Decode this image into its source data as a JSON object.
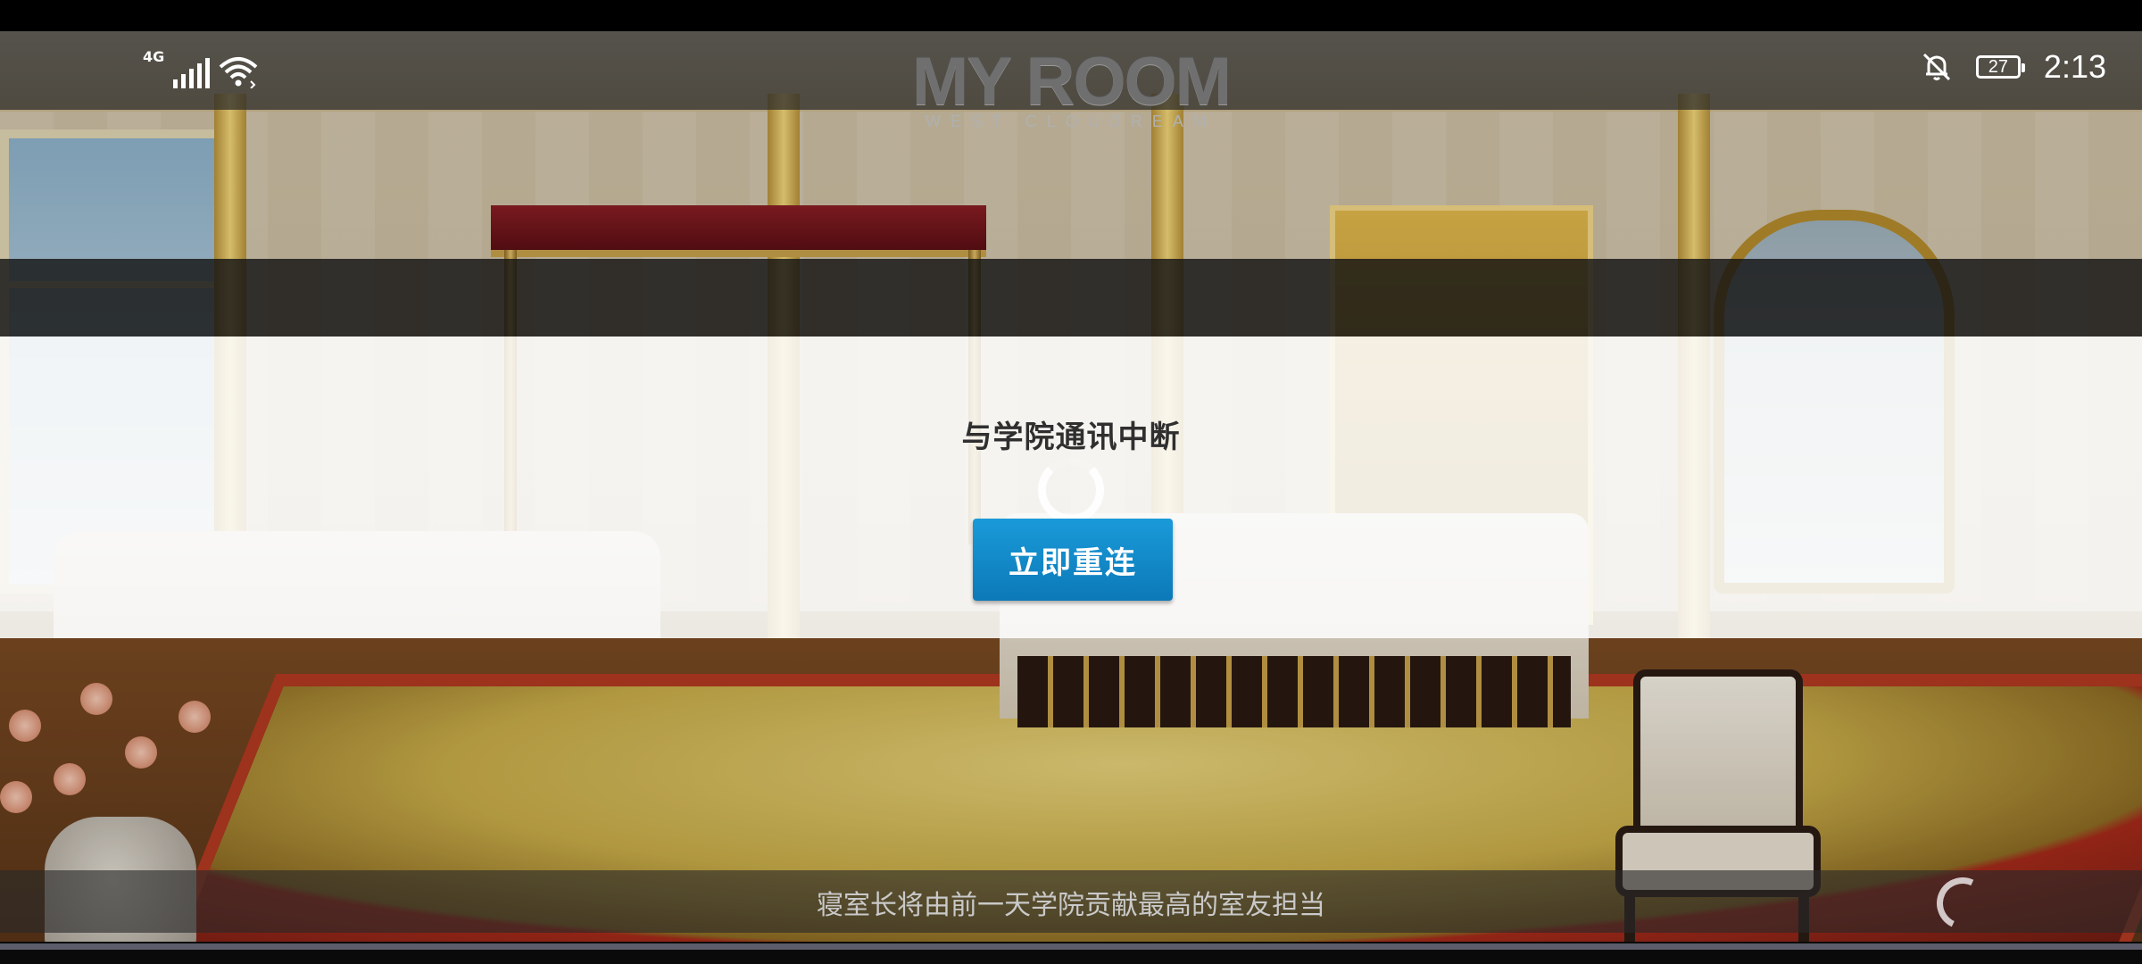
{
  "status_bar": {
    "network_type": "4G",
    "signal_icon": "cellular-signal-icon",
    "wifi_icon": "wifi-icon",
    "notification_icon": "bell-off-icon",
    "battery_level": "27",
    "time": "2:13"
  },
  "game": {
    "logo_title": "MY ROOM",
    "logo_subtitle": "WEST CLOUDREAM"
  },
  "dialog": {
    "message": "与学院通讯中断",
    "reconnect_button": "立即重连",
    "accent_color": "#138bcb"
  },
  "loading": {
    "tip": "寝室长将由前一天学院贡献最高的室友担当"
  }
}
